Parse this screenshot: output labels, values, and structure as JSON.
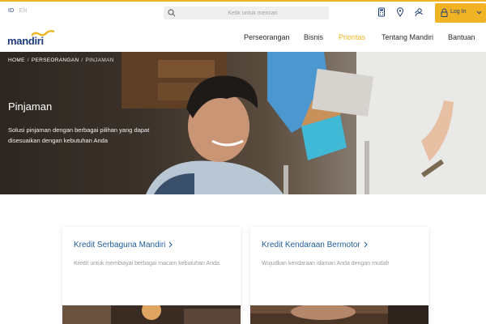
{
  "topbar": {
    "languages": [
      {
        "code": "ID",
        "active": true
      },
      {
        "code": "EN",
        "active": false
      }
    ],
    "search": {
      "placeholder": "Ketik untuk mencari"
    },
    "icons": [
      "calculator-icon",
      "location-pin-icon",
      "support-agent-icon"
    ],
    "login": {
      "label": "Log In"
    }
  },
  "brand": {
    "name": "mandiri",
    "primary_color": "#1d3d7a",
    "accent_color": "#f0b323"
  },
  "nav": {
    "items": [
      {
        "label": "Perseorangan",
        "active": false
      },
      {
        "label": "Bisnis",
        "active": false
      },
      {
        "label": "Prioritas",
        "active": true
      },
      {
        "label": "Tentang Mandiri",
        "active": false
      },
      {
        "label": "Bantuan",
        "active": false
      }
    ]
  },
  "hero": {
    "breadcrumb": [
      "HOME",
      "PERSEORANGAN",
      "PINJAMAN"
    ],
    "title": "Pinjaman",
    "description": "Solusi pinjaman dengan berbagai pilihan yang dapat disesuaikan dengan kebutuhan Anda"
  },
  "cards": [
    {
      "title": "Kredit Serbaguna Mandiri",
      "description": "Kredit untuk membiayai berbagai macam kebutuhan Anda."
    },
    {
      "title": "Kredit Kendaraan Bermotor",
      "description": "Wujudkan kendaraan idaman Anda dengan mudah"
    }
  ]
}
